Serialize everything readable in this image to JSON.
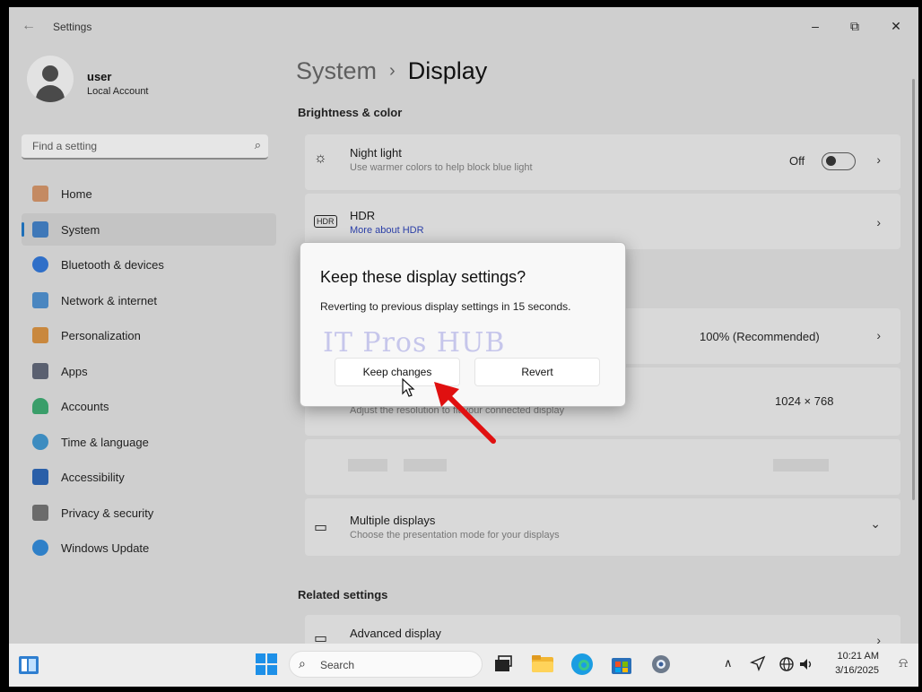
{
  "window": {
    "title": "Settings",
    "back_icon": "←",
    "minimize": "–",
    "maximize": "⧉",
    "close": "✕"
  },
  "profile": {
    "name": "user",
    "type": "Local Account"
  },
  "search": {
    "placeholder": "Find a setting",
    "icon": "⌕"
  },
  "nav": {
    "items": [
      {
        "label": "Home",
        "icon_color": "#c48a62"
      },
      {
        "label": "System",
        "icon_color": "#3f78b8"
      },
      {
        "label": "Bluetooth & devices",
        "icon_color": "#2f6fc8"
      },
      {
        "label": "Network & internet",
        "icon_color": "#4a86c0"
      },
      {
        "label": "Personalization",
        "icon_color": "#c9883e"
      },
      {
        "label": "Apps",
        "icon_color": "#5a6070"
      },
      {
        "label": "Accounts",
        "icon_color": "#3a9e6a"
      },
      {
        "label": "Time & language",
        "icon_color": "#3d8cc0"
      },
      {
        "label": "Accessibility",
        "icon_color": "#2a5fa8"
      },
      {
        "label": "Privacy & security",
        "icon_color": "#6b6b6b"
      },
      {
        "label": "Windows Update",
        "icon_color": "#2f80c8"
      }
    ],
    "active_index": 1
  },
  "breadcrumb": {
    "parent": "System",
    "separator": "›",
    "current": "Display"
  },
  "sections": {
    "brightness": "Brightness & color",
    "related": "Related settings"
  },
  "night_light": {
    "title": "Night light",
    "subtitle": "Use warmer colors to help block blue light",
    "value": "Off",
    "icon": "☼"
  },
  "hdr": {
    "title": "HDR",
    "link": "More about HDR",
    "icon": "HDR"
  },
  "scale": {
    "value": "100% (Recommended)"
  },
  "resolution": {
    "subtitle": "Adjust the resolution to fit your connected display",
    "value": "1024 × 768"
  },
  "multiple_displays": {
    "title": "Multiple displays",
    "subtitle": "Choose the presentation mode for your displays",
    "icon": "▭"
  },
  "advanced_display": {
    "title": "Advanced display"
  },
  "chevron": "›",
  "chevron_down": "⌄",
  "dialog": {
    "title": "Keep these display settings?",
    "message": "Reverting to previous display settings in 15 seconds.",
    "keep_label": "Keep changes",
    "revert_label": "Revert"
  },
  "watermark": "IT Pros HUB",
  "taskbar": {
    "search_placeholder": "Search",
    "search_icon": "⌕",
    "tray_chevron": "∧",
    "time": "10:21 AM",
    "date": "3/16/2025",
    "bell_icon": "⍾",
    "accent": "#1e6fb8"
  }
}
